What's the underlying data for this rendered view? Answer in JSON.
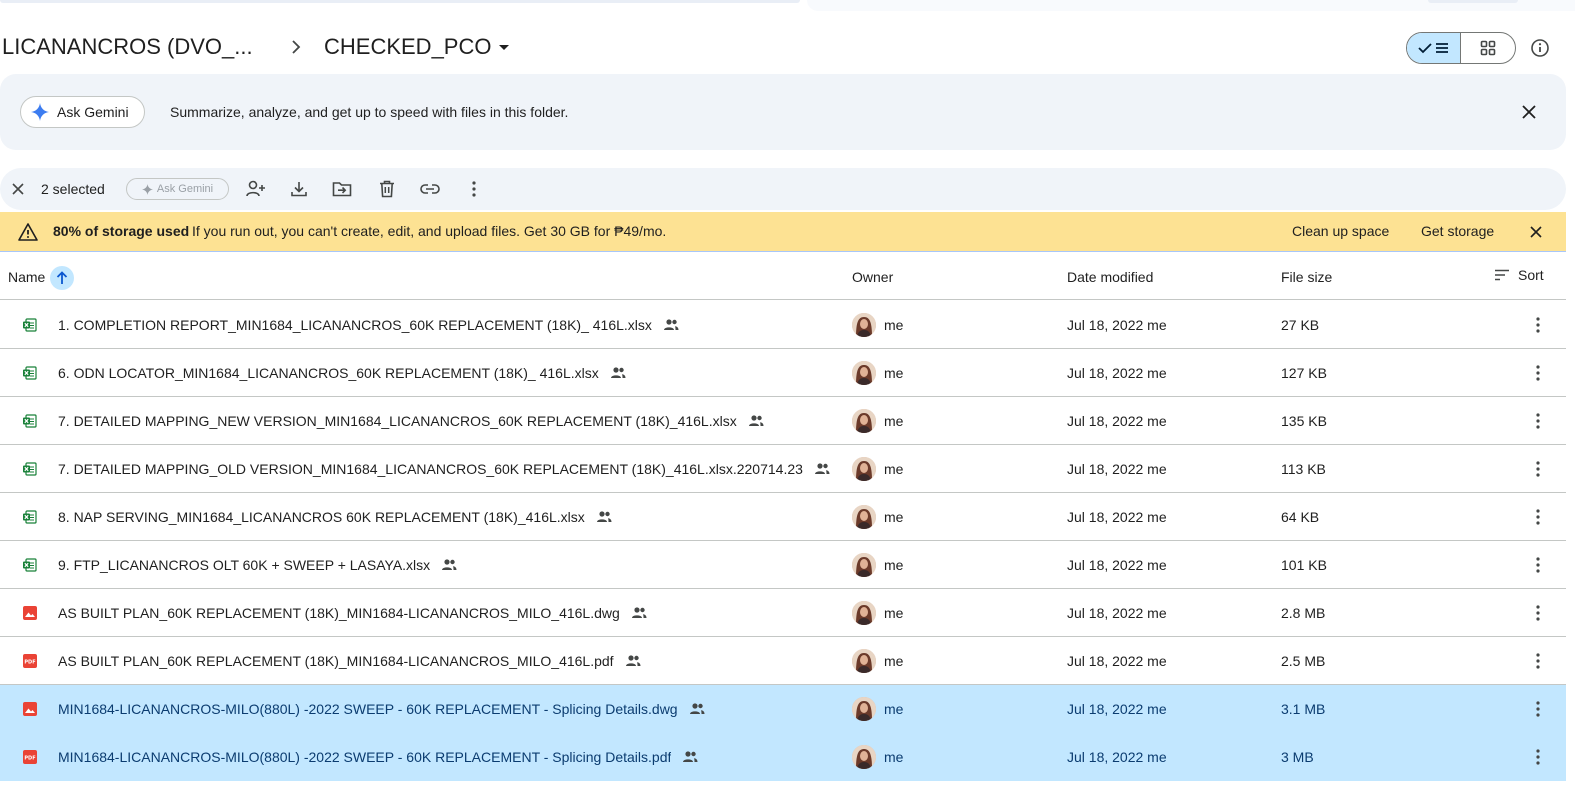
{
  "breadcrumb": {
    "parent": "LICANANCROS (DVO_...",
    "current": "CHECKED_PCO"
  },
  "gemini_banner": {
    "button_label": "Ask Gemini",
    "message": "Summarize, analyze, and get up to speed with files in this folder."
  },
  "selection_bar": {
    "count_label": "2 selected",
    "ask_gemini_label": "Ask Gemini"
  },
  "storage_warning": {
    "title": "80% of storage used",
    "message": "If you run out, you can't create, edit, and upload files. Get 30 GB for ₱49/mo.",
    "clean_up_label": "Clean up space",
    "get_storage_label": "Get storage"
  },
  "table": {
    "columns": {
      "name": "Name",
      "owner": "Owner",
      "date_modified": "Date modified",
      "file_size": "File size",
      "sort": "Sort"
    },
    "rows": [
      {
        "name": "1. COMPLETION REPORT_MIN1684_LICANANCROS_60K REPLACEMENT (18K)_ 416L.xlsx",
        "type": "xlsx",
        "owner": "me",
        "date": "Jul 18, 2022 me",
        "size": "27 KB",
        "selected": false
      },
      {
        "name": "6. ODN LOCATOR_MIN1684_LICANANCROS_60K REPLACEMENT (18K)_ 416L.xlsx",
        "type": "xlsx",
        "owner": "me",
        "date": "Jul 18, 2022 me",
        "size": "127 KB",
        "selected": false
      },
      {
        "name": "7. DETAILED MAPPING_NEW VERSION_MIN1684_LICANANCROS_60K REPLACEMENT (18K)_416L.xlsx",
        "type": "xlsx",
        "owner": "me",
        "date": "Jul 18, 2022 me",
        "size": "135 KB",
        "selected": false
      },
      {
        "name": "7. DETAILED MAPPING_OLD VERSION_MIN1684_LICANANCROS_60K REPLACEMENT (18K)_416L.xlsx.220714.231...",
        "type": "xlsx",
        "owner": "me",
        "date": "Jul 18, 2022 me",
        "size": "113 KB",
        "selected": false
      },
      {
        "name": "8. NAP SERVING_MIN1684_LICANANCROS 60K REPLACEMENT (18K)_416L.xlsx",
        "type": "xlsx",
        "owner": "me",
        "date": "Jul 18, 2022 me",
        "size": "64 KB",
        "selected": false
      },
      {
        "name": "9. FTP_LICANANCROS OLT 60K + SWEEP + LASAYA.xlsx",
        "type": "xlsx",
        "owner": "me",
        "date": "Jul 18, 2022 me",
        "size": "101 KB",
        "selected": false
      },
      {
        "name": "AS BUILT PLAN_60K REPLACEMENT (18K)_MIN1684-LICANANCROS_MILO_416L.dwg",
        "type": "image",
        "owner": "me",
        "date": "Jul 18, 2022 me",
        "size": "2.8 MB",
        "selected": false
      },
      {
        "name": "AS BUILT PLAN_60K REPLACEMENT (18K)_MIN1684-LICANANCROS_MILO_416L.pdf",
        "type": "pdf",
        "owner": "me",
        "date": "Jul 18, 2022 me",
        "size": "2.5 MB",
        "selected": false
      },
      {
        "name": "MIN1684-LICANANCROS-MILO(880L) -2022 SWEEP - 60K REPLACEMENT - Splicing Details.dwg",
        "type": "image",
        "owner": "me",
        "date": "Jul 18, 2022 me",
        "size": "3.1 MB",
        "selected": true
      },
      {
        "name": "MIN1684-LICANANCROS-MILO(880L) -2022 SWEEP - 60K REPLACEMENT - Splicing Details.pdf",
        "type": "pdf",
        "owner": "me",
        "date": "Jul 18, 2022 me",
        "size": "3 MB",
        "selected": true
      }
    ]
  },
  "colors": {
    "selected_row": "#c2e7ff",
    "warning_bg": "#fde293",
    "banner_bg": "#f0f4f9",
    "excel_green": "#188038",
    "pdf_red": "#ea4335"
  }
}
